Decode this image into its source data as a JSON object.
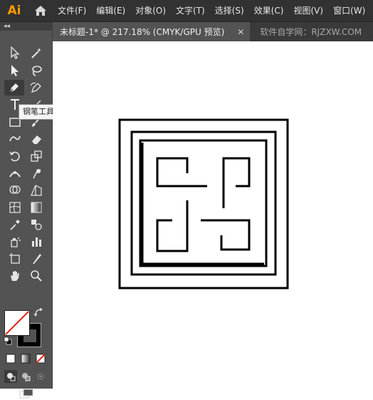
{
  "app": {
    "logo_text": "Ai"
  },
  "menu": {
    "items": [
      {
        "label": "文件(F)"
      },
      {
        "label": "编辑(E)"
      },
      {
        "label": "对象(O)"
      },
      {
        "label": "文字(T)"
      },
      {
        "label": "选择(S)"
      },
      {
        "label": "效果(C)"
      },
      {
        "label": "视图(V)"
      },
      {
        "label": "窗口(W)"
      }
    ]
  },
  "tabs": {
    "active": {
      "label": "未标题-1* @ 217.18% (CMYK/GPU 预览)",
      "close": "✕"
    },
    "inactive": {
      "label": "软件自学网：RJZXW.COM"
    }
  },
  "toolbar": {
    "collapse": "◂◂",
    "tooltip": "钢笔工具 (P)",
    "tools": [
      "selection-icon",
      "direct-selection-icon",
      "magic-wand-icon",
      "lasso-icon",
      "pen-icon",
      "curvature-icon",
      "type-icon",
      "line-segment-icon",
      "rectangle-icon",
      "paintbrush-icon",
      "shaper-icon",
      "eraser-icon",
      "rotate-icon",
      "scale-icon",
      "width-icon",
      "puppet-warp-icon",
      "shape-builder-icon",
      "perspective-grid-icon",
      "mesh-icon",
      "gradient-icon",
      "eyedropper-icon",
      "blend-icon",
      "symbol-sprayer-icon",
      "column-graph-icon",
      "artboard-icon",
      "slice-icon",
      "hand-icon",
      "zoom-icon"
    ]
  },
  "colors": {
    "accent": "#ff9a00",
    "panel": "#535353",
    "menubar": "#323232",
    "fill": "#ffffff",
    "stroke": "#000000"
  }
}
